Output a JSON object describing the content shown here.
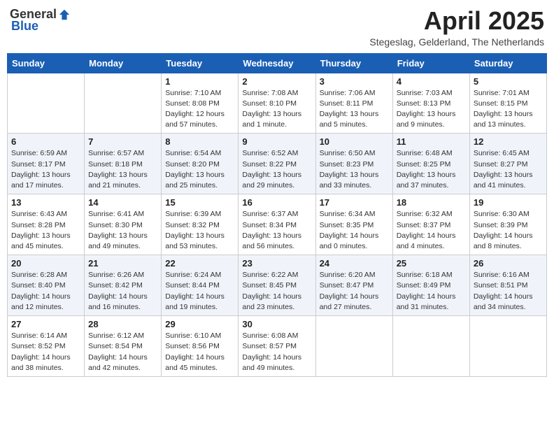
{
  "logo": {
    "general": "General",
    "blue": "Blue"
  },
  "title": "April 2025",
  "subtitle": "Stegeslag, Gelderland, The Netherlands",
  "weekdays": [
    "Sunday",
    "Monday",
    "Tuesday",
    "Wednesday",
    "Thursday",
    "Friday",
    "Saturday"
  ],
  "weeks": [
    [
      {
        "day": "",
        "sunrise": "",
        "sunset": "",
        "daylight": ""
      },
      {
        "day": "",
        "sunrise": "",
        "sunset": "",
        "daylight": ""
      },
      {
        "day": "1",
        "sunrise": "Sunrise: 7:10 AM",
        "sunset": "Sunset: 8:08 PM",
        "daylight": "Daylight: 12 hours and 57 minutes."
      },
      {
        "day": "2",
        "sunrise": "Sunrise: 7:08 AM",
        "sunset": "Sunset: 8:10 PM",
        "daylight": "Daylight: 13 hours and 1 minute."
      },
      {
        "day": "3",
        "sunrise": "Sunrise: 7:06 AM",
        "sunset": "Sunset: 8:11 PM",
        "daylight": "Daylight: 13 hours and 5 minutes."
      },
      {
        "day": "4",
        "sunrise": "Sunrise: 7:03 AM",
        "sunset": "Sunset: 8:13 PM",
        "daylight": "Daylight: 13 hours and 9 minutes."
      },
      {
        "day": "5",
        "sunrise": "Sunrise: 7:01 AM",
        "sunset": "Sunset: 8:15 PM",
        "daylight": "Daylight: 13 hours and 13 minutes."
      }
    ],
    [
      {
        "day": "6",
        "sunrise": "Sunrise: 6:59 AM",
        "sunset": "Sunset: 8:17 PM",
        "daylight": "Daylight: 13 hours and 17 minutes."
      },
      {
        "day": "7",
        "sunrise": "Sunrise: 6:57 AM",
        "sunset": "Sunset: 8:18 PM",
        "daylight": "Daylight: 13 hours and 21 minutes."
      },
      {
        "day": "8",
        "sunrise": "Sunrise: 6:54 AM",
        "sunset": "Sunset: 8:20 PM",
        "daylight": "Daylight: 13 hours and 25 minutes."
      },
      {
        "day": "9",
        "sunrise": "Sunrise: 6:52 AM",
        "sunset": "Sunset: 8:22 PM",
        "daylight": "Daylight: 13 hours and 29 minutes."
      },
      {
        "day": "10",
        "sunrise": "Sunrise: 6:50 AM",
        "sunset": "Sunset: 8:23 PM",
        "daylight": "Daylight: 13 hours and 33 minutes."
      },
      {
        "day": "11",
        "sunrise": "Sunrise: 6:48 AM",
        "sunset": "Sunset: 8:25 PM",
        "daylight": "Daylight: 13 hours and 37 minutes."
      },
      {
        "day": "12",
        "sunrise": "Sunrise: 6:45 AM",
        "sunset": "Sunset: 8:27 PM",
        "daylight": "Daylight: 13 hours and 41 minutes."
      }
    ],
    [
      {
        "day": "13",
        "sunrise": "Sunrise: 6:43 AM",
        "sunset": "Sunset: 8:28 PM",
        "daylight": "Daylight: 13 hours and 45 minutes."
      },
      {
        "day": "14",
        "sunrise": "Sunrise: 6:41 AM",
        "sunset": "Sunset: 8:30 PM",
        "daylight": "Daylight: 13 hours and 49 minutes."
      },
      {
        "day": "15",
        "sunrise": "Sunrise: 6:39 AM",
        "sunset": "Sunset: 8:32 PM",
        "daylight": "Daylight: 13 hours and 53 minutes."
      },
      {
        "day": "16",
        "sunrise": "Sunrise: 6:37 AM",
        "sunset": "Sunset: 8:34 PM",
        "daylight": "Daylight: 13 hours and 56 minutes."
      },
      {
        "day": "17",
        "sunrise": "Sunrise: 6:34 AM",
        "sunset": "Sunset: 8:35 PM",
        "daylight": "Daylight: 14 hours and 0 minutes."
      },
      {
        "day": "18",
        "sunrise": "Sunrise: 6:32 AM",
        "sunset": "Sunset: 8:37 PM",
        "daylight": "Daylight: 14 hours and 4 minutes."
      },
      {
        "day": "19",
        "sunrise": "Sunrise: 6:30 AM",
        "sunset": "Sunset: 8:39 PM",
        "daylight": "Daylight: 14 hours and 8 minutes."
      }
    ],
    [
      {
        "day": "20",
        "sunrise": "Sunrise: 6:28 AM",
        "sunset": "Sunset: 8:40 PM",
        "daylight": "Daylight: 14 hours and 12 minutes."
      },
      {
        "day": "21",
        "sunrise": "Sunrise: 6:26 AM",
        "sunset": "Sunset: 8:42 PM",
        "daylight": "Daylight: 14 hours and 16 minutes."
      },
      {
        "day": "22",
        "sunrise": "Sunrise: 6:24 AM",
        "sunset": "Sunset: 8:44 PM",
        "daylight": "Daylight: 14 hours and 19 minutes."
      },
      {
        "day": "23",
        "sunrise": "Sunrise: 6:22 AM",
        "sunset": "Sunset: 8:45 PM",
        "daylight": "Daylight: 14 hours and 23 minutes."
      },
      {
        "day": "24",
        "sunrise": "Sunrise: 6:20 AM",
        "sunset": "Sunset: 8:47 PM",
        "daylight": "Daylight: 14 hours and 27 minutes."
      },
      {
        "day": "25",
        "sunrise": "Sunrise: 6:18 AM",
        "sunset": "Sunset: 8:49 PM",
        "daylight": "Daylight: 14 hours and 31 minutes."
      },
      {
        "day": "26",
        "sunrise": "Sunrise: 6:16 AM",
        "sunset": "Sunset: 8:51 PM",
        "daylight": "Daylight: 14 hours and 34 minutes."
      }
    ],
    [
      {
        "day": "27",
        "sunrise": "Sunrise: 6:14 AM",
        "sunset": "Sunset: 8:52 PM",
        "daylight": "Daylight: 14 hours and 38 minutes."
      },
      {
        "day": "28",
        "sunrise": "Sunrise: 6:12 AM",
        "sunset": "Sunset: 8:54 PM",
        "daylight": "Daylight: 14 hours and 42 minutes."
      },
      {
        "day": "29",
        "sunrise": "Sunrise: 6:10 AM",
        "sunset": "Sunset: 8:56 PM",
        "daylight": "Daylight: 14 hours and 45 minutes."
      },
      {
        "day": "30",
        "sunrise": "Sunrise: 6:08 AM",
        "sunset": "Sunset: 8:57 PM",
        "daylight": "Daylight: 14 hours and 49 minutes."
      },
      {
        "day": "",
        "sunrise": "",
        "sunset": "",
        "daylight": ""
      },
      {
        "day": "",
        "sunrise": "",
        "sunset": "",
        "daylight": ""
      },
      {
        "day": "",
        "sunrise": "",
        "sunset": "",
        "daylight": ""
      }
    ]
  ]
}
